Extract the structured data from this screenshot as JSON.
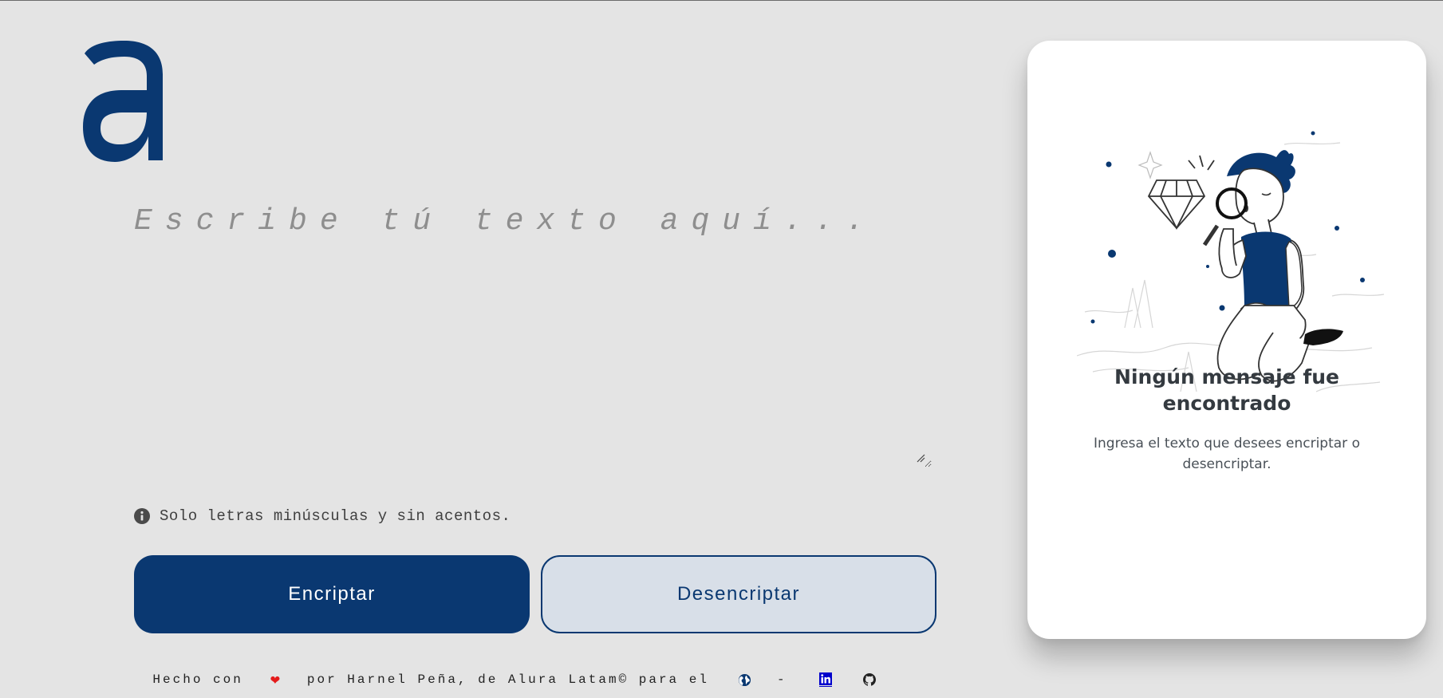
{
  "logo": {
    "letter": "a",
    "icon": "alura-logo",
    "color": "#0a3871"
  },
  "input": {
    "placeholder": "Escribe tú texto aquí...",
    "value": ""
  },
  "notice": {
    "icon": "info-circle-icon",
    "text": "Solo letras minúsculas y sin acentos."
  },
  "buttons": {
    "encrypt_label": "Encriptar",
    "decrypt_label": "Desencriptar"
  },
  "footer": {
    "made_with": "Hecho con",
    "heart_icon": "❤",
    "by_text": "por Harnel Peña, de Alura Latam© para el",
    "separator": "-",
    "icons": [
      "globe-icon",
      "linkedin-icon",
      "github-icon"
    ]
  },
  "output_panel": {
    "illustration": "person-with-magnifying-glass-illustration",
    "title": "Ningún mensaje fue encontrado",
    "text": "Ingresa el texto que desees encriptar o desencriptar."
  },
  "colors": {
    "background": "#e4e4e4",
    "primary": "#0a3871",
    "secondary_button_bg": "#d8dfe8",
    "panel_bg": "#ffffff",
    "heart": "#e41b1b"
  }
}
